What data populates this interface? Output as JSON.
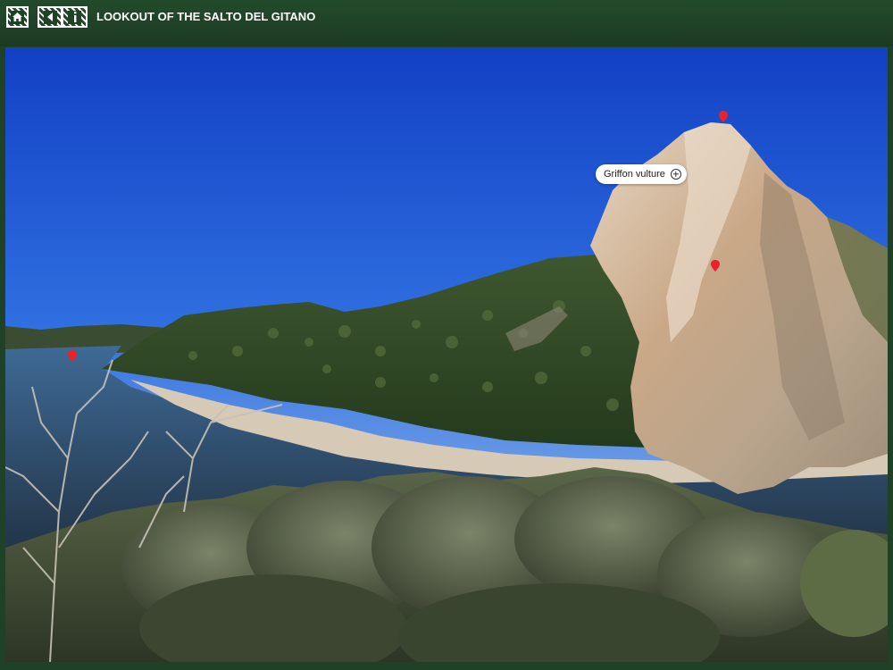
{
  "app": {
    "title": "LOOKOUT OF THE SALTO DEL GITANO"
  },
  "toolbar": {
    "home_icon": "home-icon",
    "back_icon": "back-arrow-icon",
    "info_icon": "info-icon"
  },
  "panorama": {
    "scene": "Salto del Gitano rock face above the Tajo river, Monfragüe",
    "hotspots": [
      {
        "label": "Griffon vulture",
        "icon": "plus-circle-icon"
      }
    ],
    "pins_color": "#e8222e"
  },
  "colors": {
    "header_bg": "#1f4126",
    "sky_top": "#1546c9",
    "sky_bottom": "#8fb6e8",
    "pin": "#e8222e"
  }
}
